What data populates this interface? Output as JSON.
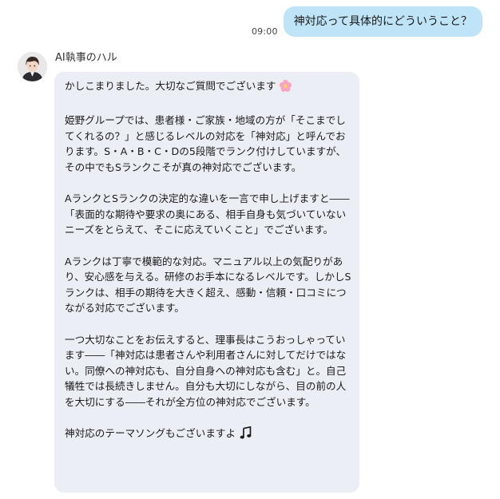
{
  "outgoing": {
    "time": "09:00",
    "text": "神対応って具体的にどういうこと？"
  },
  "incoming": {
    "sender": "AI執事のハル",
    "paragraphs": [
      "かしこまりました。大切なご質問でございます",
      "姫野グループでは、患者様・ご家族・地域の方が「そこまでしてくれるの？」と感じるレベルの対応を「神対応」と呼んでおります。S・A・B・C・Dの5段階でランク付けしていますが、その中でもSランクこそが真の神対応でございます。",
      "AランクとSランクの決定的な違いを一言で申し上げますと――「表面的な期待や要求の奥にある、相手自身も気づいていないニーズをとらえて、そこに応えていくこと」でございます。",
      "Aランクは丁寧で模範的な対応。マニュアル以上の気配りがあり、安心感を与える。研修のお手本になるレベルです。しかしSランクは、相手の期待を大きく超え、感動・信頼・口コミにつながる対応でございます。",
      "一つ大切なことをお伝えすると、理事長はこうおっしゃっています――「神対応は患者さんや利用者さんに対してだけではない。同僚への神対応も、自分自身への神対応も含む」と。自己犠牲では長続きしません。自分も大切にしながら、目の前の人を大切にする――それが全方位の神対応でございます。",
      "神対応のテーマソングもございますよ"
    ],
    "first_emoji": "cherry-blossom-icon",
    "last_emoji": "music-note-icon"
  },
  "colors": {
    "outgoing_bubble": "#bfe4f7",
    "incoming_bubble": "#eceef6"
  }
}
